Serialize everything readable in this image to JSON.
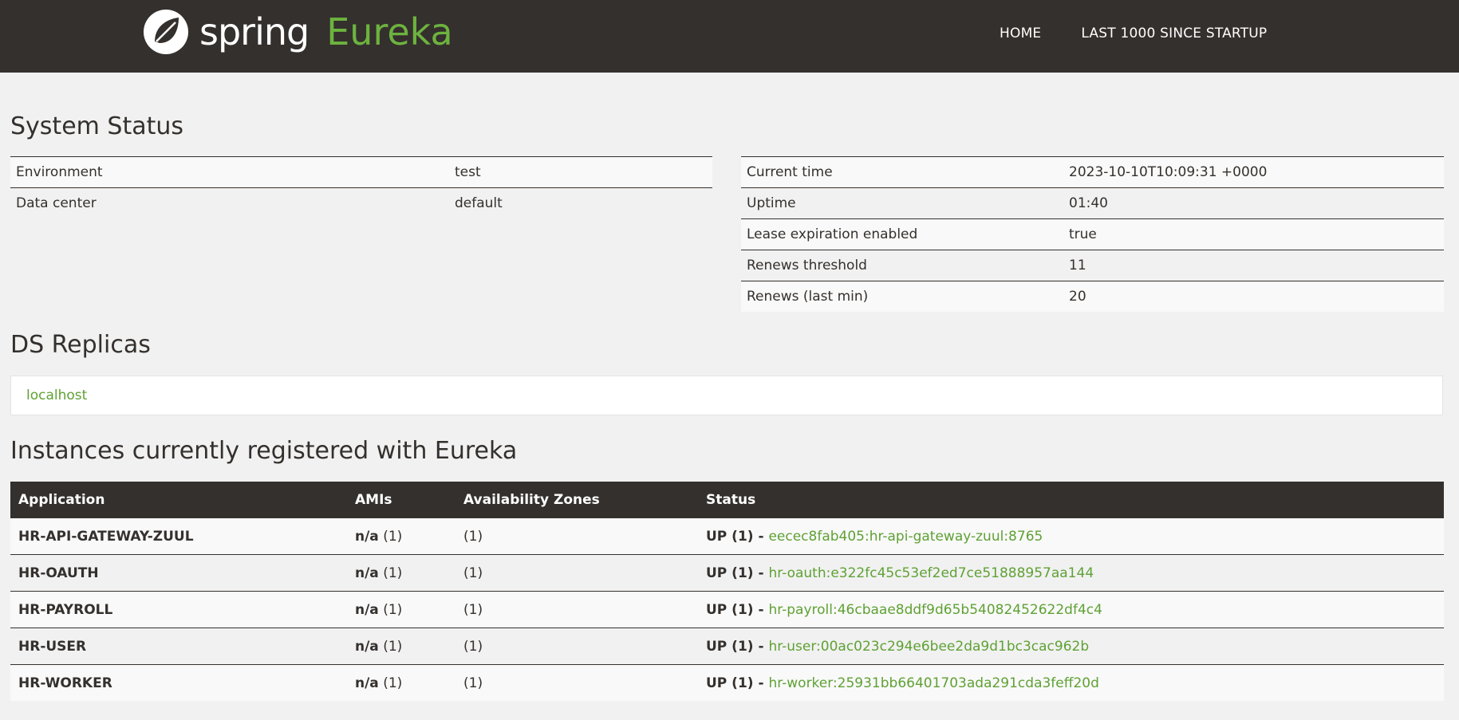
{
  "nav": {
    "brand_spring": "spring",
    "brand_eureka": "Eureka",
    "links": [
      "HOME",
      "LAST 1000 SINCE STARTUP"
    ]
  },
  "system_status": {
    "title": "System Status",
    "left": [
      {
        "label": "Environment",
        "value": "test"
      },
      {
        "label": "Data center",
        "value": "default"
      }
    ],
    "right": [
      {
        "label": "Current time",
        "value": "2023-10-10T10:09:31 +0000"
      },
      {
        "label": "Uptime",
        "value": "01:40"
      },
      {
        "label": "Lease expiration enabled",
        "value": "true"
      },
      {
        "label": "Renews threshold",
        "value": "11"
      },
      {
        "label": "Renews (last min)",
        "value": "20"
      }
    ]
  },
  "ds_replicas": {
    "title": "DS Replicas",
    "items": [
      "localhost"
    ]
  },
  "instances": {
    "title": "Instances currently registered with Eureka",
    "headers": [
      "Application",
      "AMIs",
      "Availability Zones",
      "Status"
    ],
    "rows": [
      {
        "app": "HR-API-GATEWAY-ZUUL",
        "ami_na": "n/a",
        "ami_count": "(1)",
        "zones": "(1)",
        "status": "UP (1) - ",
        "instance": "eecec8fab405:hr-api-gateway-zuul:8765"
      },
      {
        "app": "HR-OAUTH",
        "ami_na": "n/a",
        "ami_count": "(1)",
        "zones": "(1)",
        "status": "UP (1) - ",
        "instance": "hr-oauth:e322fc45c53ef2ed7ce51888957aa144"
      },
      {
        "app": "HR-PAYROLL",
        "ami_na": "n/a",
        "ami_count": "(1)",
        "zones": "(1)",
        "status": "UP (1) - ",
        "instance": "hr-payroll:46cbaae8ddf9d65b54082452622df4c4"
      },
      {
        "app": "HR-USER",
        "ami_na": "n/a",
        "ami_count": "(1)",
        "zones": "(1)",
        "status": "UP (1) - ",
        "instance": "hr-user:00ac023c294e6bee2da9d1bc3cac962b"
      },
      {
        "app": "HR-WORKER",
        "ami_na": "n/a",
        "ami_count": "(1)",
        "zones": "(1)",
        "status": "UP (1) - ",
        "instance": "hr-worker:25931bb66401703ada291cda3feff20d"
      }
    ]
  },
  "colors": {
    "nav_bg": "#34302d",
    "accent_green": "#6db33f",
    "link_green": "#5fa134",
    "page_bg": "#f1f1f1"
  }
}
